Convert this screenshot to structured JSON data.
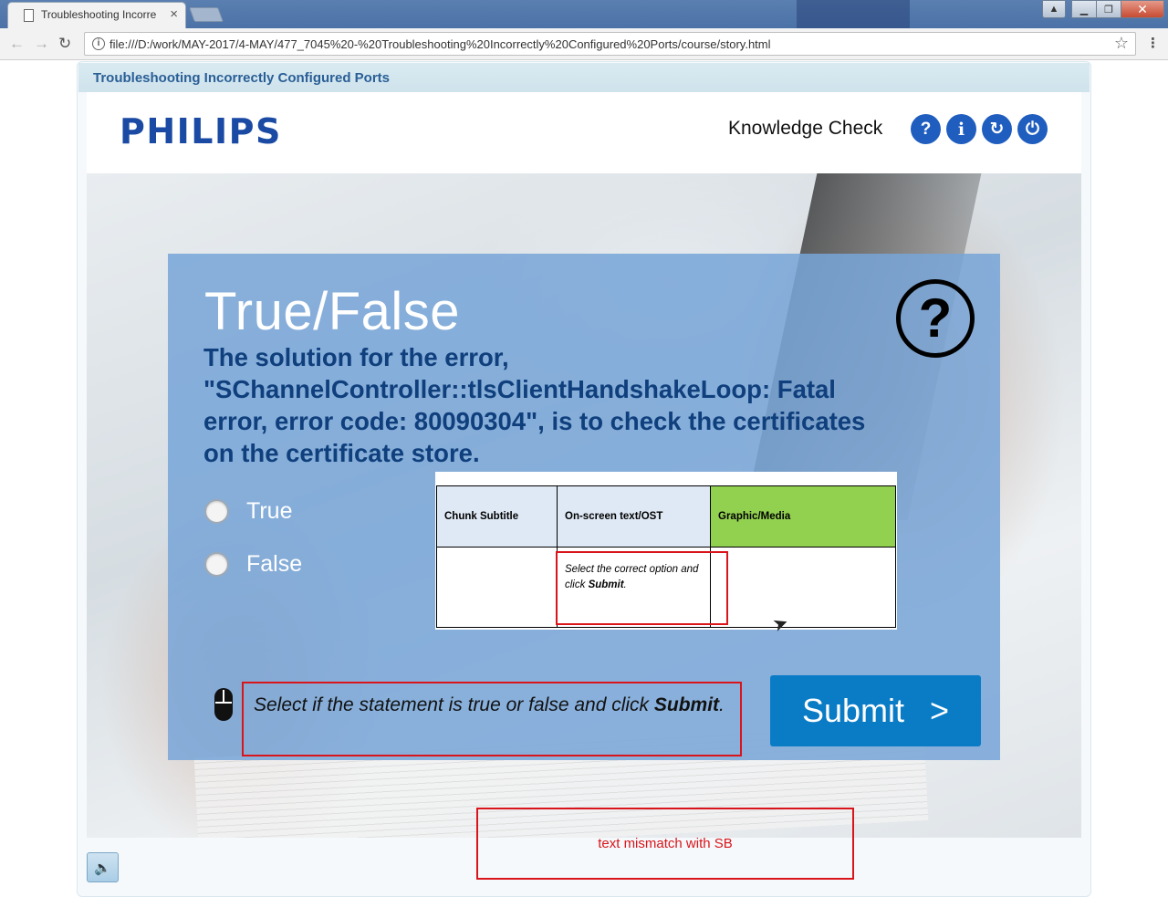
{
  "browser": {
    "tab_title": "Troubleshooting Incorre",
    "url": "file:///D:/work/MAY-2017/4-MAY/477_7045%20-%20Troubleshooting%20Incorrectly%20Configured%20Ports/course/story.html"
  },
  "course": {
    "title": "Troubleshooting Incorrectly Configured Ports",
    "logo_text": "PHILIPS",
    "section_title": "Knowledge Check",
    "header_buttons": {
      "help": "?",
      "info": "i",
      "replay": "↻",
      "exit": "⏻"
    }
  },
  "question": {
    "type": "True/False",
    "text": "The solution for the error, \"SChannelController::tlsClientHandshakeLoop: Fatal error, error code: 80090304\", is to check the certificates on the certificate store.",
    "options": [
      "True",
      "False"
    ],
    "icon": "question-circle-icon"
  },
  "storyboard_table": {
    "headers": [
      "Chunk Subtitle",
      "On-screen text/OST",
      "Graphic/Media"
    ],
    "row": [
      "",
      "Select the correct option and click ",
      ""
    ],
    "row_bold": "Submit",
    "row_tail": "."
  },
  "instruction": {
    "text_pre": "Select if the statement is true or false and click ",
    "text_bold": "Submit",
    "text_post": "."
  },
  "submit_button": {
    "label": "Submit",
    "arrow": ">"
  },
  "review_comment": "text mismatch with SB",
  "colors": {
    "accent": "#1f5dbf",
    "submit": "#0a7cc6",
    "review_red": "#d9151b",
    "panel": "#78a5d7"
  }
}
